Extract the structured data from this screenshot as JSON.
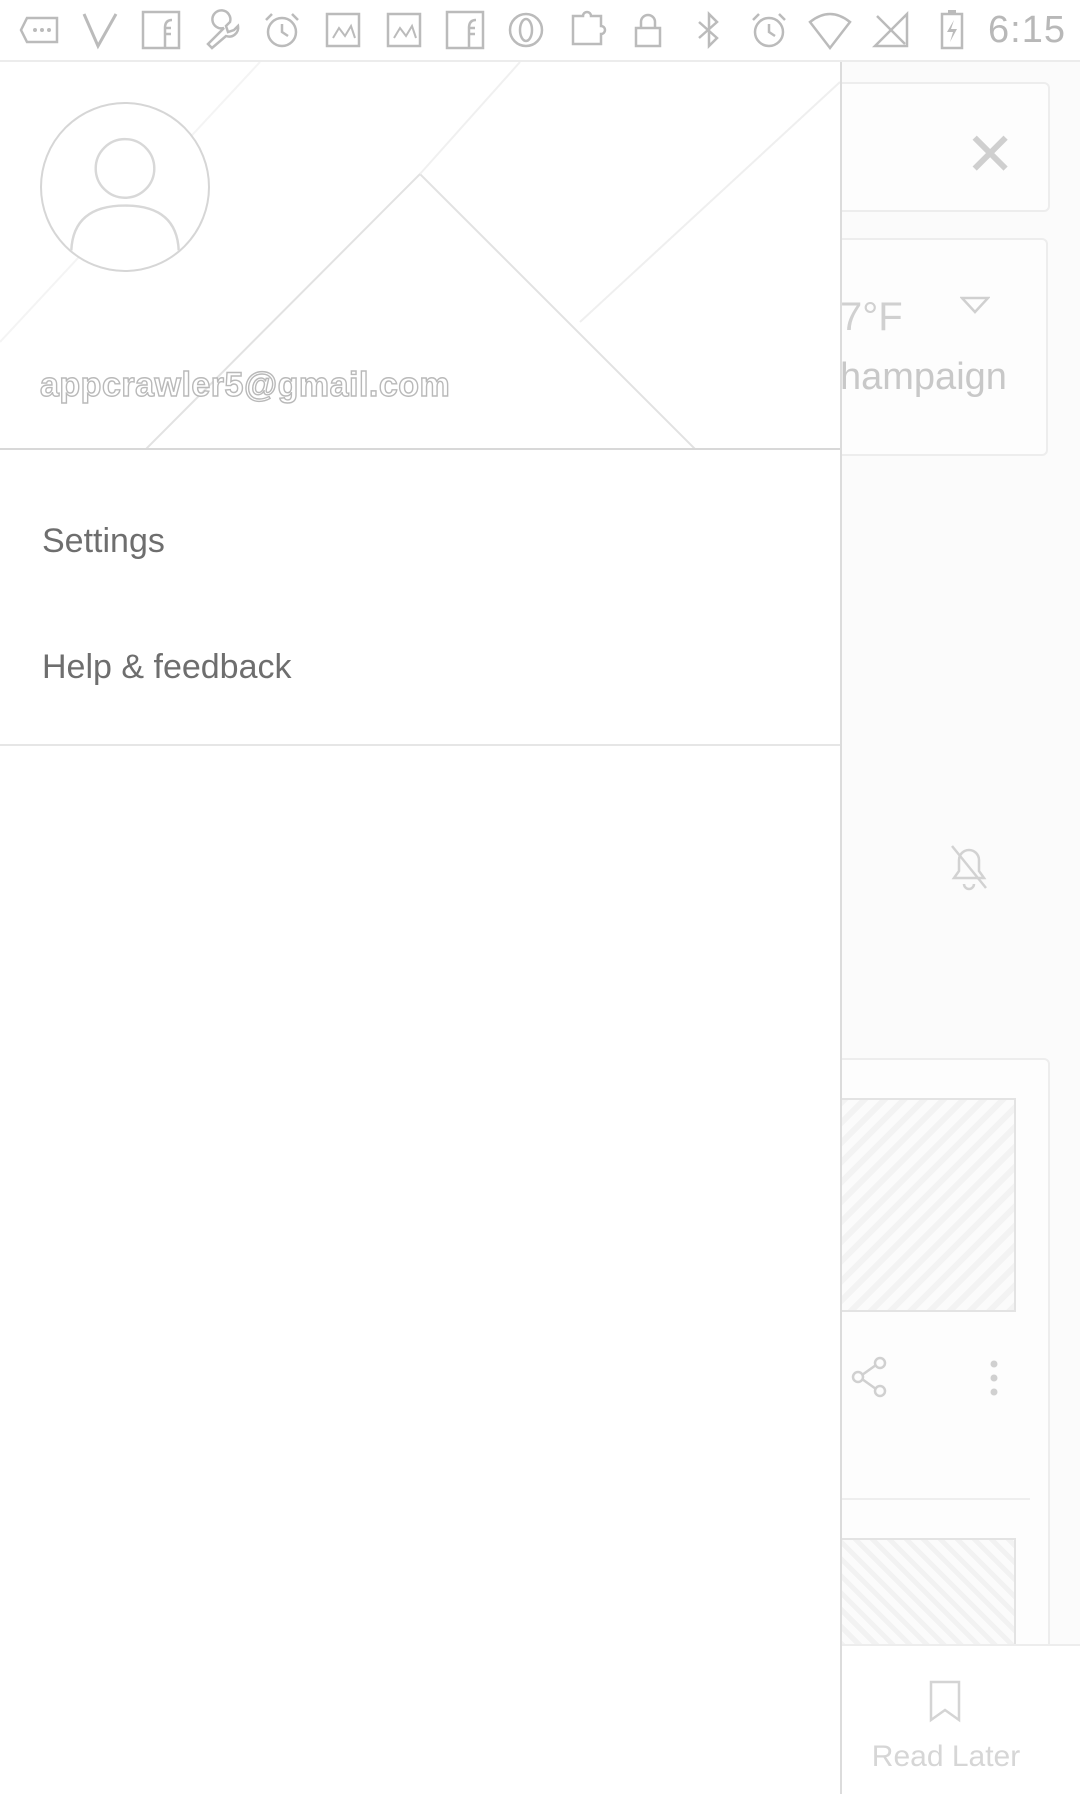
{
  "status_bar": {
    "time": "6:15",
    "icons": [
      "message-icon",
      "vine-icon",
      "facebook-icon",
      "wrench-icon",
      "alarm-icon",
      "photo-icon",
      "photo-icon",
      "facebook-icon",
      "opera-icon",
      "puzzle-icon",
      "lock-icon",
      "bluetooth-icon",
      "alarm-icon",
      "wifi-icon",
      "no-signal-icon",
      "battery-charging-icon"
    ]
  },
  "drawer": {
    "account_email": "appcrawler5@gmail.com",
    "menu_items": [
      {
        "label": "Settings"
      },
      {
        "label": "Help & feedback"
      }
    ]
  },
  "background_app": {
    "close_glyph": "✕",
    "temperature": "7°F",
    "city": "hampaign",
    "bottom_nav": {
      "read_later_label": "Read Later"
    }
  }
}
